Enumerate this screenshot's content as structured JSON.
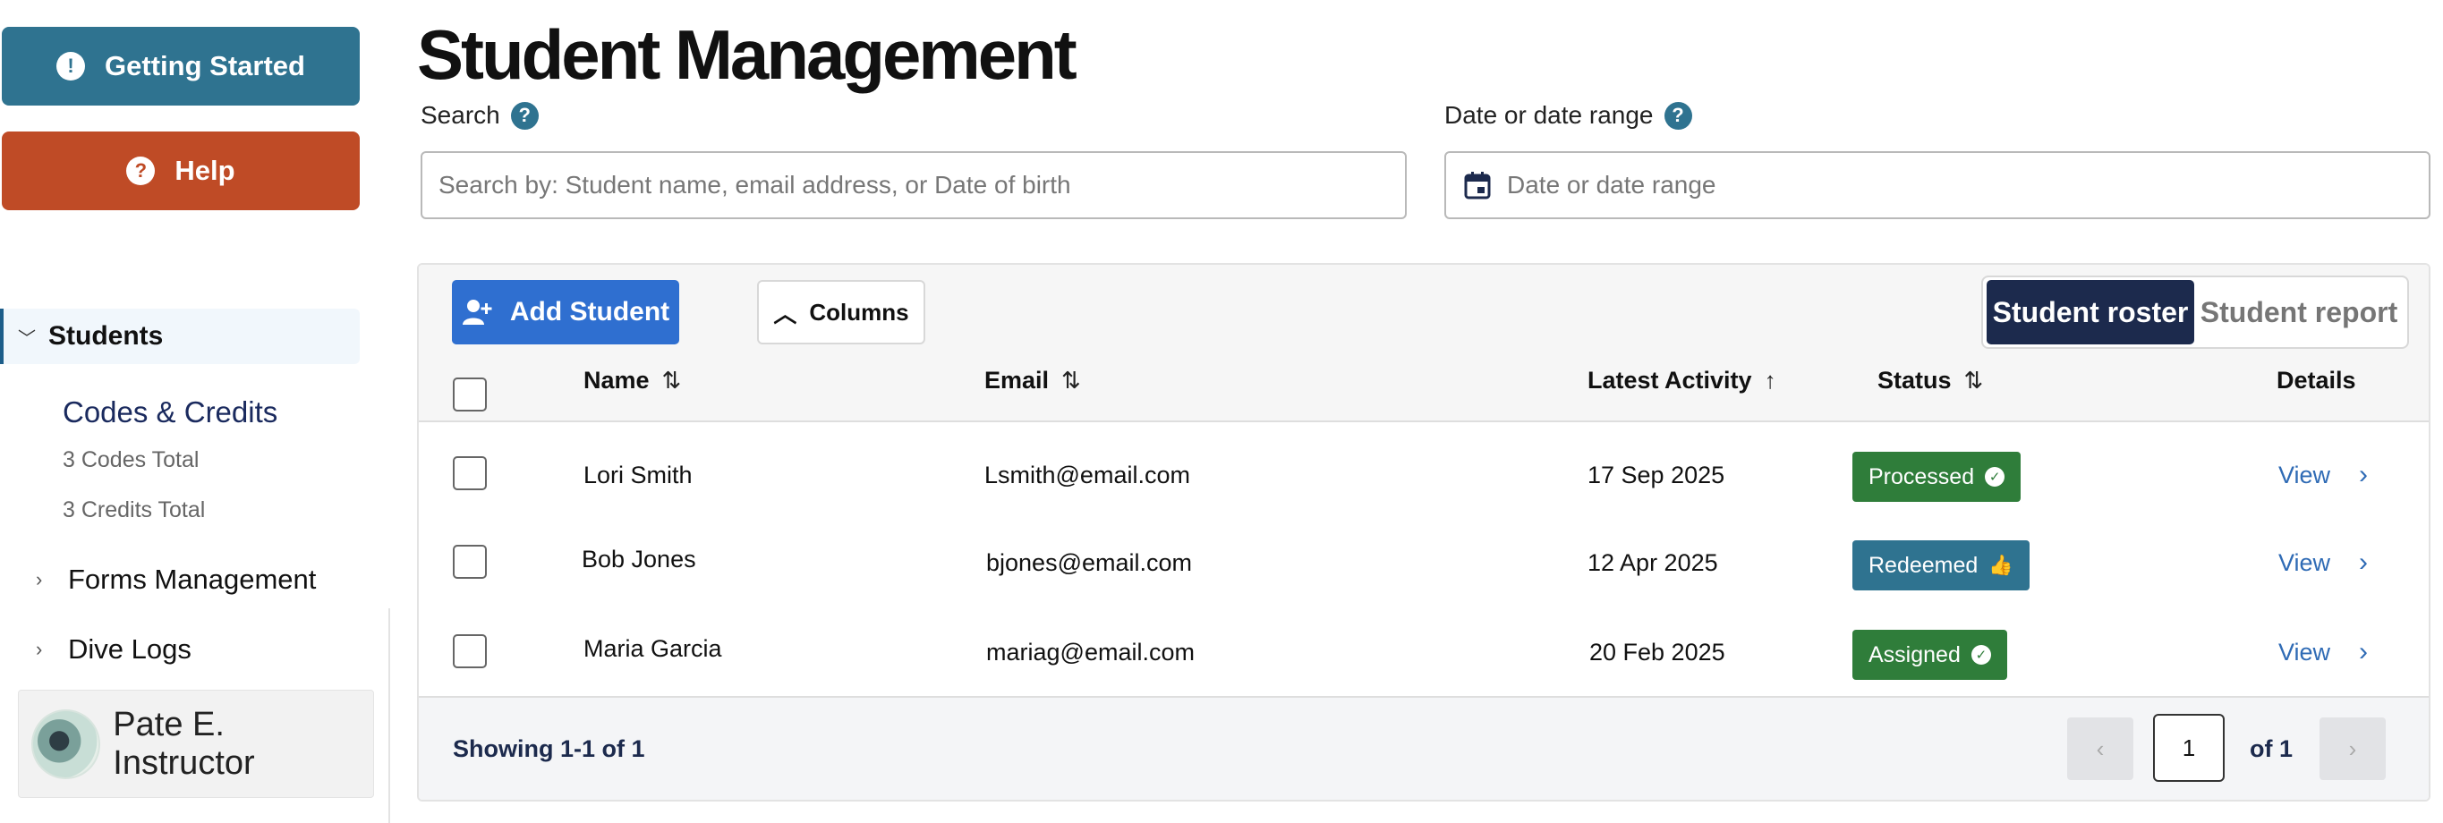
{
  "sidebar": {
    "getting_started": "Getting Started",
    "getting_started_icon": "!",
    "help": "Help",
    "help_icon": "?",
    "nav": {
      "students": "Students",
      "codes_credits": "Codes & Credits",
      "codes_total": "3 Codes Total",
      "credits_total": "3 Credits Total",
      "forms": "Forms Management",
      "dive_logs": "Dive Logs"
    },
    "user": {
      "name": "Pate E. Instructor"
    }
  },
  "main": {
    "title": "Student Management",
    "search": {
      "label": "Search",
      "placeholder": "Search by: Student name, email address, or Date of birth"
    },
    "date": {
      "label": "Date or date range",
      "placeholder": "Date or date range"
    },
    "help_icon": "?"
  },
  "toolbar": {
    "add_student": "Add Student",
    "columns": "Columns",
    "view_toggle": {
      "active": "Student roster",
      "inactive": "Student report"
    }
  },
  "table": {
    "columns": {
      "name": "Name",
      "email": "Email",
      "latest_activity": "Latest Activity",
      "status": "Status",
      "details": "Details"
    },
    "sort_icons": {
      "both": "⇅",
      "up": "↑"
    },
    "rows": [
      {
        "name": "Lori Smith",
        "email": "Lsmith@email.com",
        "activity": "17 Sep 2025",
        "status": "Processed",
        "status_icon": "✓",
        "details": "View"
      },
      {
        "name": "Bob Jones",
        "email": "bjones@email.com",
        "activity": "12 Apr 2025",
        "status": "Redeemed",
        "status_icon": "👍",
        "details": "View"
      },
      {
        "name": "Maria Garcia",
        "email": "mariag@email.com",
        "activity": "20 Feb 2025",
        "status": "Assigned",
        "status_icon": "✓",
        "details": "View"
      }
    ],
    "colors": {
      "processed": "#2f7d3a",
      "redeemed": "#2f7390",
      "assigned": "#2f7d3a"
    }
  },
  "footer": {
    "showing": "Showing 1-1 of 1",
    "page": "1",
    "of": "of 1",
    "prev": "‹",
    "next": "›"
  }
}
